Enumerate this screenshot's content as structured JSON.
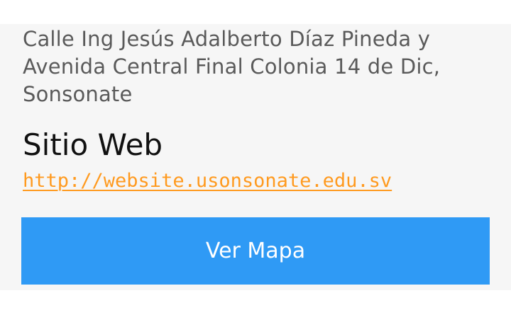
{
  "contact": {
    "address": "Calle Ing  Jesús Adalberto Díaz Pineda y\nAvenida Central Final Colonia 14 de Dic,\nSonsonate",
    "website_title": "Sitio Web",
    "website_url": "http://website.usonsonate.edu.sv"
  },
  "actions": {
    "map_button_label": "Ver Mapa"
  },
  "colors": {
    "link": "#ff9a1f",
    "button": "#2f9af5",
    "card_background": "#f6f6f6"
  }
}
